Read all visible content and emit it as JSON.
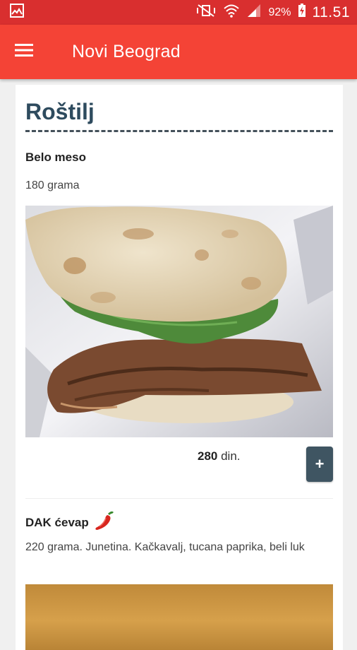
{
  "status_bar": {
    "battery_percent": "92%",
    "time": "11.51"
  },
  "app_bar": {
    "title": "Novi Beograd"
  },
  "section": {
    "title": "Roštilj"
  },
  "items": [
    {
      "name": "Belo meso",
      "description": "180 grama",
      "price_value": "280",
      "price_unit": " din.",
      "add_label": "+"
    },
    {
      "name": "DAK ćevap",
      "spicy_icon": "chili-pepper-icon",
      "description": "220 grama. Junetina. Kačkavalj, tucana paprika, beli luk"
    }
  ],
  "colors": {
    "status_bar": "#d92f2f",
    "app_bar": "#f44336",
    "title": "#2e4b5e",
    "add_button": "#3f5562"
  }
}
